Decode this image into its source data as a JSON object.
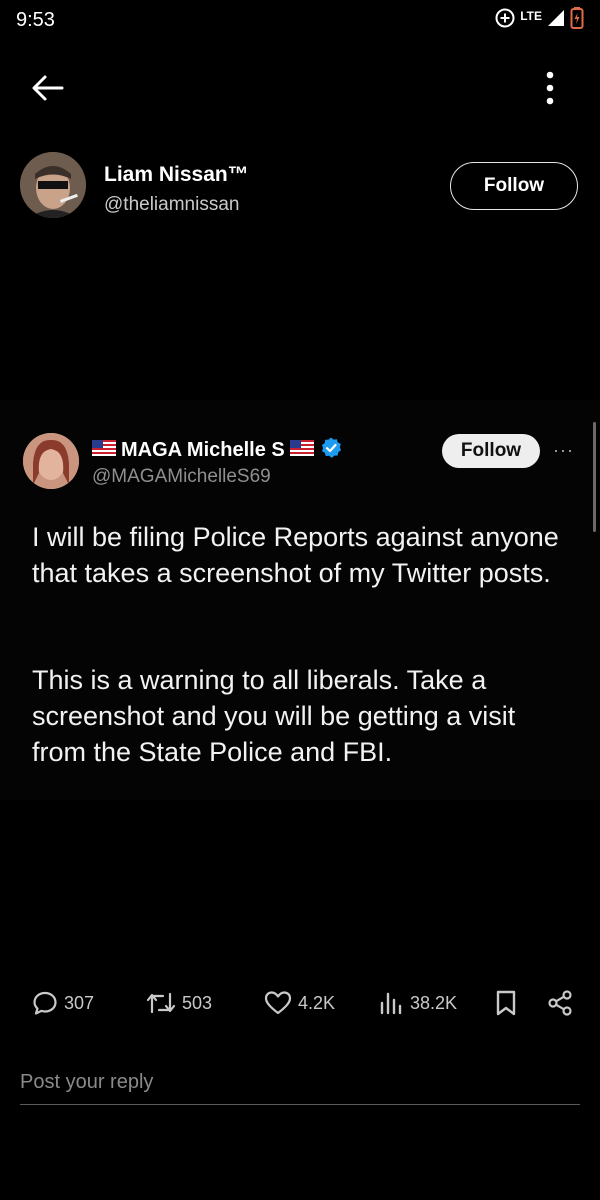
{
  "status_bar": {
    "time": "9:53",
    "network": "LTE"
  },
  "author": {
    "name": "Liam Nissan™",
    "handle": "@theliamnissan",
    "follow_label": "Follow"
  },
  "embedded_post": {
    "name": "MAGA Michelle S",
    "handle": "@MAGAMichelleS69",
    "follow_label": "Follow",
    "more": "···",
    "paragraph_1": "I will be filing Police Reports against anyone that takes a screenshot of my Twitter posts.",
    "paragraph_2": "This is a warning to all liberals. Take a screenshot and you will be getting a visit from the State Police and FBI.",
    "verified_color": "#1d9bf0"
  },
  "actions": {
    "replies": "307",
    "reposts": "503",
    "likes": "4.2K",
    "views": "38.2K"
  },
  "reply": {
    "placeholder": "Post your reply"
  }
}
